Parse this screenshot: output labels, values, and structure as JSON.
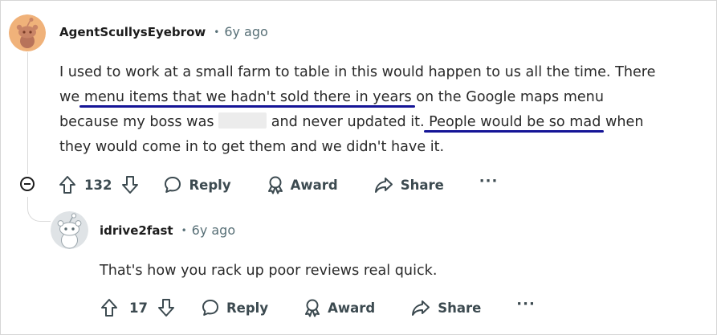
{
  "comment1": {
    "username": "AgentScullysEyebrow",
    "separator": "•",
    "age": "6y ago",
    "body": {
      "line1": "I used to work at a small farm to table in this would happen to us all the time. There",
      "line2_pre": "we ",
      "line2_underlined": "menu items that we hadn't sold there in years",
      "line2_post": " on the Google maps menu",
      "line3_pre": "because my boss was ",
      "line3_mid": " and never updated it. ",
      "line3_underlined": "People would be so mad",
      "line3_post": " when",
      "line4": "they would come in to get them and we didn't have it."
    },
    "votes": "132",
    "actions": {
      "reply": "Reply",
      "award": "Award",
      "share": "Share",
      "more": "···"
    }
  },
  "comment2": {
    "username": "idrive2fast",
    "separator": "•",
    "age": "6y ago",
    "body": "That's how you rack up poor reviews real quick.",
    "votes": "17",
    "actions": {
      "reply": "Reply",
      "award": "Award",
      "share": "Share",
      "more": "···"
    }
  },
  "colors": {
    "underline": "#141496",
    "avatar1_bg": "#f0b27a",
    "avatar2_bg": "#dfe3e6",
    "meta_text": "#576f76"
  },
  "icons": {
    "collapse": "minus-circle-icon",
    "upvote": "arrow-up-icon",
    "downvote": "arrow-down-icon",
    "reply": "speech-bubble-icon",
    "award": "award-ribbon-icon",
    "share": "share-arrow-icon",
    "more": "ellipsis-icon"
  }
}
